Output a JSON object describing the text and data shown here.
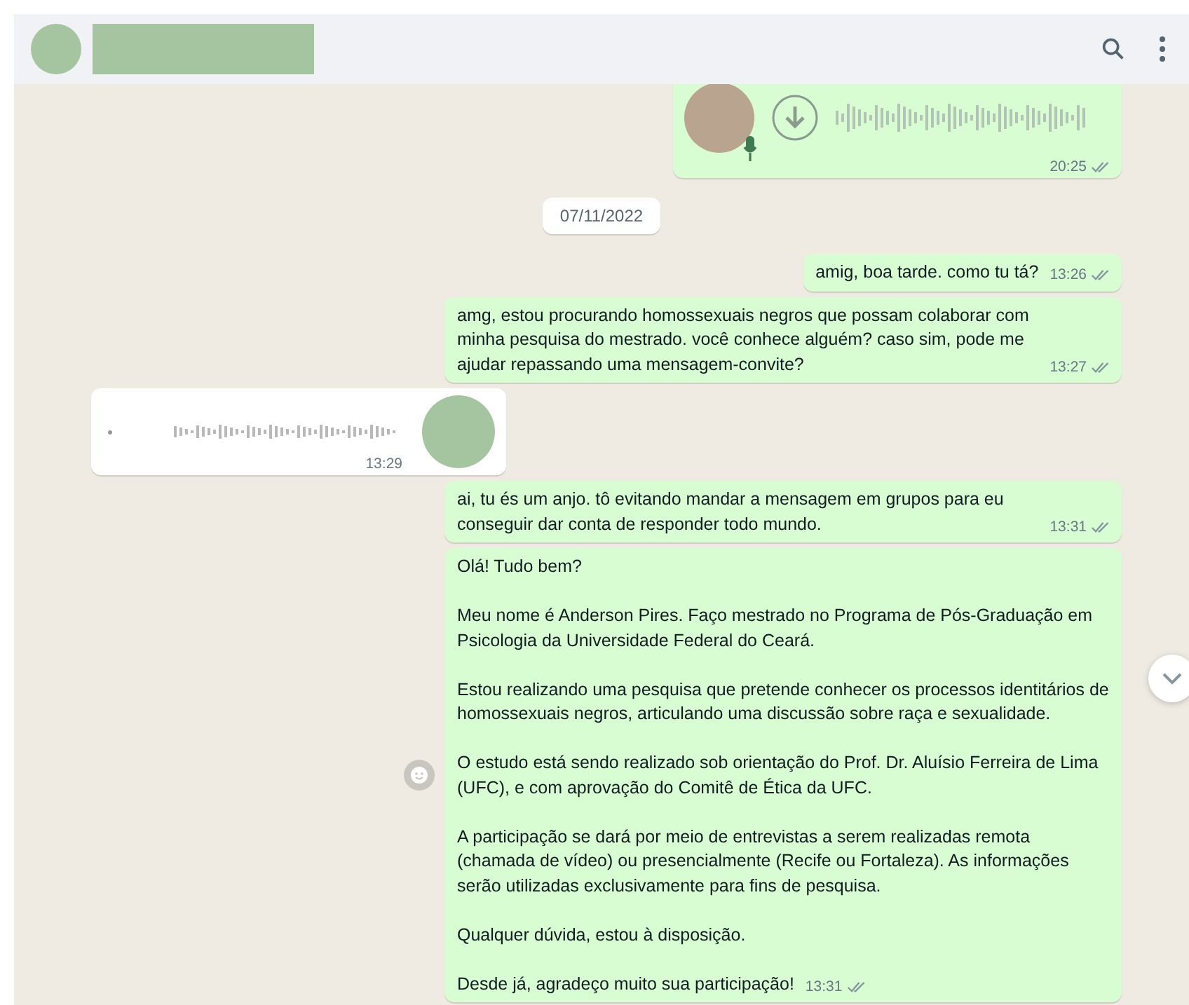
{
  "messages": [
    {
      "kind": "voice",
      "outgoing": true,
      "time": "20:25"
    },
    {
      "kind": "date",
      "text": "07/11/2022"
    },
    {
      "kind": "text",
      "outgoing": true,
      "paragraphs": [
        "amig, boa tarde. como tu tá?"
      ],
      "time": "13:26"
    },
    {
      "kind": "text",
      "outgoing": true,
      "paragraphs": [
        "amg, estou procurando homossexuais negros que possam colaborar com minha pesquisa do mestrado. você conhece alguém? caso sim, pode me ajudar repassando uma mensagem-convite?"
      ],
      "time": "13:27"
    },
    {
      "kind": "voice",
      "outgoing": false,
      "time": "13:29"
    },
    {
      "kind": "text",
      "outgoing": true,
      "paragraphs": [
        "ai, tu és um anjo. tô evitando mandar a mensagem em grupos para eu conseguir dar conta de responder todo mundo."
      ],
      "time": "13:31"
    },
    {
      "kind": "text",
      "outgoing": true,
      "reaction_button": true,
      "paragraphs": [
        "Olá! Tudo bem?",
        "Meu nome é Anderson Pires. Faço mestrado no Programa de Pós-Graduação em Psicologia da Universidade Federal do Ceará.",
        "Estou realizando uma pesquisa que pretende conhecer os processos identitários de homossexuais negros, articulando uma discussão sobre raça e sexualidade.",
        "O estudo está sendo realizado sob orientação do Prof. Dr. Aluísio Ferreira de Lima (UFC), e com aprovação do Comitê de Ética da UFC.",
        "A participação se dará por meio de entrevistas a serem realizadas remota (chamada de vídeo) ou presencialmente (Recife ou Fortaleza). As informações serão utilizadas exclusivamente para fins de pesquisa.",
        "Qualquer dúvida, estou à disposição.",
        "Desde já, agradeço muito sua participação!"
      ],
      "time": "13:31"
    }
  ]
}
